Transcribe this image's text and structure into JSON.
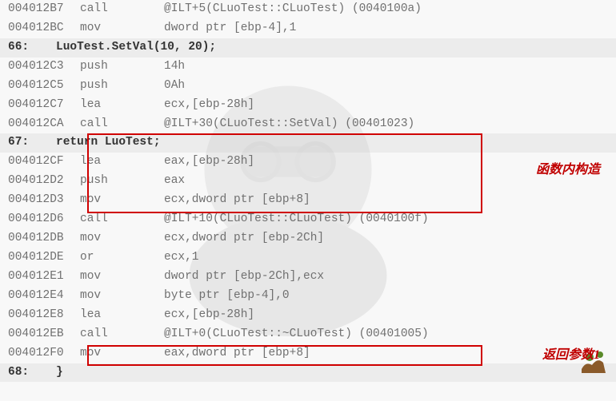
{
  "lines": [
    {
      "type": "asm",
      "hl": false,
      "addr": "004012B7",
      "mnemonic": "call",
      "operands": "@ILT+5(CLuoTest::CLuoTest) (0040100a)"
    },
    {
      "type": "asm",
      "hl": false,
      "addr": "004012BC",
      "mnemonic": "mov",
      "operands": "dword ptr [ebp-4],1"
    },
    {
      "type": "src",
      "hl": true,
      "lineNum": "66:",
      "source": "LuoTest.SetVal(10, 20);"
    },
    {
      "type": "asm",
      "hl": false,
      "addr": "004012C3",
      "mnemonic": "push",
      "operands": "14h"
    },
    {
      "type": "asm",
      "hl": false,
      "addr": "004012C5",
      "mnemonic": "push",
      "operands": "0Ah"
    },
    {
      "type": "asm",
      "hl": false,
      "addr": "004012C7",
      "mnemonic": "lea",
      "operands": "ecx,[ebp-28h]"
    },
    {
      "type": "asm",
      "hl": false,
      "addr": "004012CA",
      "mnemonic": "call",
      "operands": "@ILT+30(CLuoTest::SetVal) (00401023)"
    },
    {
      "type": "src",
      "hl": true,
      "lineNum": "67:",
      "source": "return LuoTest;"
    },
    {
      "type": "asm",
      "hl": false,
      "addr": "004012CF",
      "mnemonic": "lea",
      "operands": "eax,[ebp-28h]"
    },
    {
      "type": "asm",
      "hl": false,
      "addr": "004012D2",
      "mnemonic": "push",
      "operands": "eax"
    },
    {
      "type": "asm",
      "hl": false,
      "addr": "004012D3",
      "mnemonic": "mov",
      "operands": "ecx,dword ptr [ebp+8]"
    },
    {
      "type": "asm",
      "hl": false,
      "addr": "004012D6",
      "mnemonic": "call",
      "operands": "@ILT+10(CLuoTest::CLuoTest) (0040100f)"
    },
    {
      "type": "asm",
      "hl": false,
      "addr": "004012DB",
      "mnemonic": "mov",
      "operands": "ecx,dword ptr [ebp-2Ch]"
    },
    {
      "type": "asm",
      "hl": false,
      "addr": "004012DE",
      "mnemonic": "or",
      "operands": "ecx,1"
    },
    {
      "type": "asm",
      "hl": false,
      "addr": "004012E1",
      "mnemonic": "mov",
      "operands": "dword ptr [ebp-2Ch],ecx"
    },
    {
      "type": "asm",
      "hl": false,
      "addr": "004012E4",
      "mnemonic": "mov",
      "operands": "byte ptr [ebp-4],0"
    },
    {
      "type": "asm",
      "hl": false,
      "addr": "004012E8",
      "mnemonic": "lea",
      "operands": "ecx,[ebp-28h]"
    },
    {
      "type": "asm",
      "hl": false,
      "addr": "004012EB",
      "mnemonic": "call",
      "operands": "@ILT+0(CLuoTest::~CLuoTest) (00401005)"
    },
    {
      "type": "asm",
      "hl": false,
      "addr": "004012F0",
      "mnemonic": "mov",
      "operands": "eax,dword ptr [ebp+8]"
    },
    {
      "type": "src",
      "hl": true,
      "lineNum": "68:",
      "source": "}"
    }
  ],
  "annotations": {
    "box1": "函数内构造",
    "box2": "返回参数1"
  }
}
